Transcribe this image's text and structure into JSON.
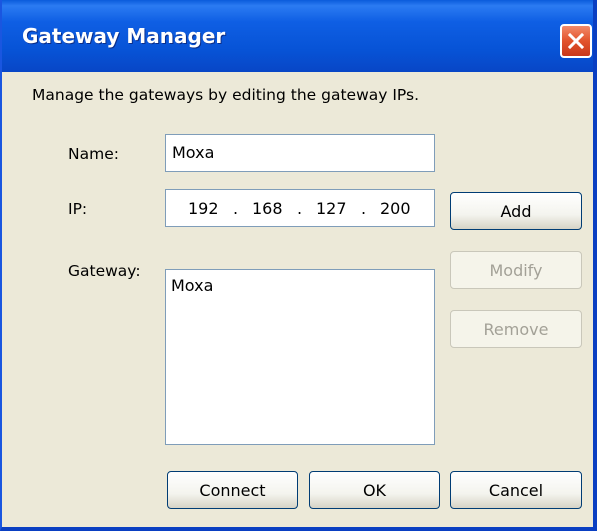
{
  "window": {
    "title": "Gateway Manager"
  },
  "intro_text": "Manage the gateways by editing the gateway IPs.",
  "name_field": {
    "label": "Name:",
    "value": "Moxa"
  },
  "ip_field": {
    "label": "IP:",
    "octets": [
      "192",
      "168",
      "127",
      "200"
    ],
    "separator": "."
  },
  "gateway_field": {
    "label": "Gateway:",
    "items": [
      "Moxa"
    ]
  },
  "buttons": {
    "add": "Add",
    "modify": "Modify",
    "remove": "Remove",
    "connect": "Connect",
    "ok": "OK",
    "cancel": "Cancel"
  },
  "icons": {
    "close": "close-icon"
  },
  "colors": {
    "titlebar": "#0753d6",
    "close_button": "#e2532c",
    "dialog_background": "#ece9d8",
    "disabled_text": "#a3a197"
  }
}
